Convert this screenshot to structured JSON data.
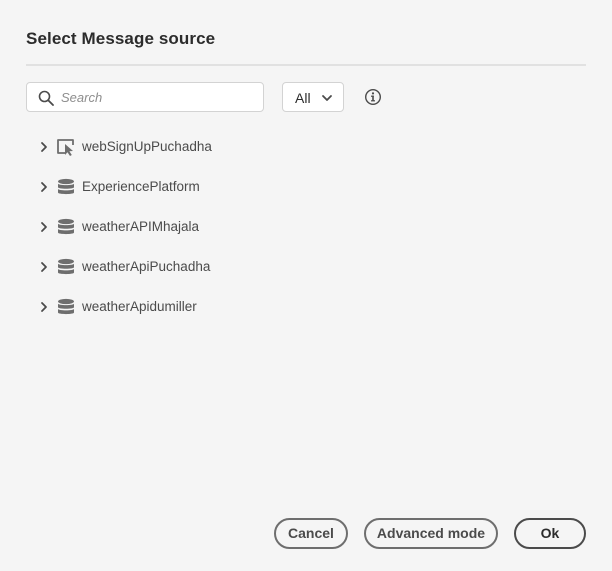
{
  "dialog": {
    "title": "Select Message source"
  },
  "search": {
    "placeholder": "Search",
    "value": "",
    "icon": "search-icon"
  },
  "filter": {
    "selected": "All",
    "icon": "chevron-down-icon"
  },
  "info": {
    "icon": "info-icon"
  },
  "sources": [
    {
      "label": "webSignUpPuchadha",
      "icon": "web-cursor-icon"
    },
    {
      "label": "ExperiencePlatform",
      "icon": "database-icon"
    },
    {
      "label": "weatherAPIMhajala",
      "icon": "database-icon"
    },
    {
      "label": "weatherApiPuchadha",
      "icon": "database-icon"
    },
    {
      "label": "weatherApidumiller",
      "icon": "database-icon"
    }
  ],
  "footer": {
    "cancel_label": "Cancel",
    "advanced_label": "Advanced mode",
    "ok_label": "Ok"
  },
  "colors": {
    "background": "#f5f5f5",
    "text": "#2c2c2c",
    "muted_text": "#4b4b4b",
    "icon": "#6e6e6e",
    "border": "#d3d3d3"
  }
}
